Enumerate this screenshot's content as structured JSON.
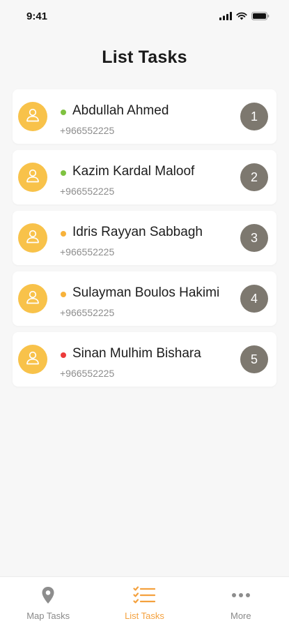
{
  "status_bar": {
    "time": "9:41"
  },
  "page": {
    "title": "List Tasks"
  },
  "colors": {
    "accent": "#f4a13e",
    "avatar": "#f8c24a",
    "number_badge": "#7d786f",
    "status_green": "#7fc241",
    "status_orange": "#f7b23b",
    "status_red": "#ec3b3b"
  },
  "tasks": [
    {
      "name": "Abdullah Ahmed",
      "phone": "+966552225",
      "number": "1",
      "status": "green"
    },
    {
      "name": "Kazim Kardal Maloof",
      "phone": "+966552225",
      "number": "2",
      "status": "green"
    },
    {
      "name": "Idris Rayyan Sabbagh",
      "phone": "+966552225",
      "number": "3",
      "status": "orange"
    },
    {
      "name": "Sulayman Boulos Hakimi",
      "phone": "+966552225",
      "number": "4",
      "status": "orange"
    },
    {
      "name": "Sinan Mulhim Bishara",
      "phone": "+966552225",
      "number": "5",
      "status": "red"
    }
  ],
  "tab_bar": {
    "tabs": [
      {
        "label": "Map Tasks",
        "icon": "map-pin-icon",
        "active": false
      },
      {
        "label": "List Tasks",
        "icon": "list-icon",
        "active": true
      },
      {
        "label": "More",
        "icon": "more-dots-icon",
        "active": false
      }
    ]
  }
}
